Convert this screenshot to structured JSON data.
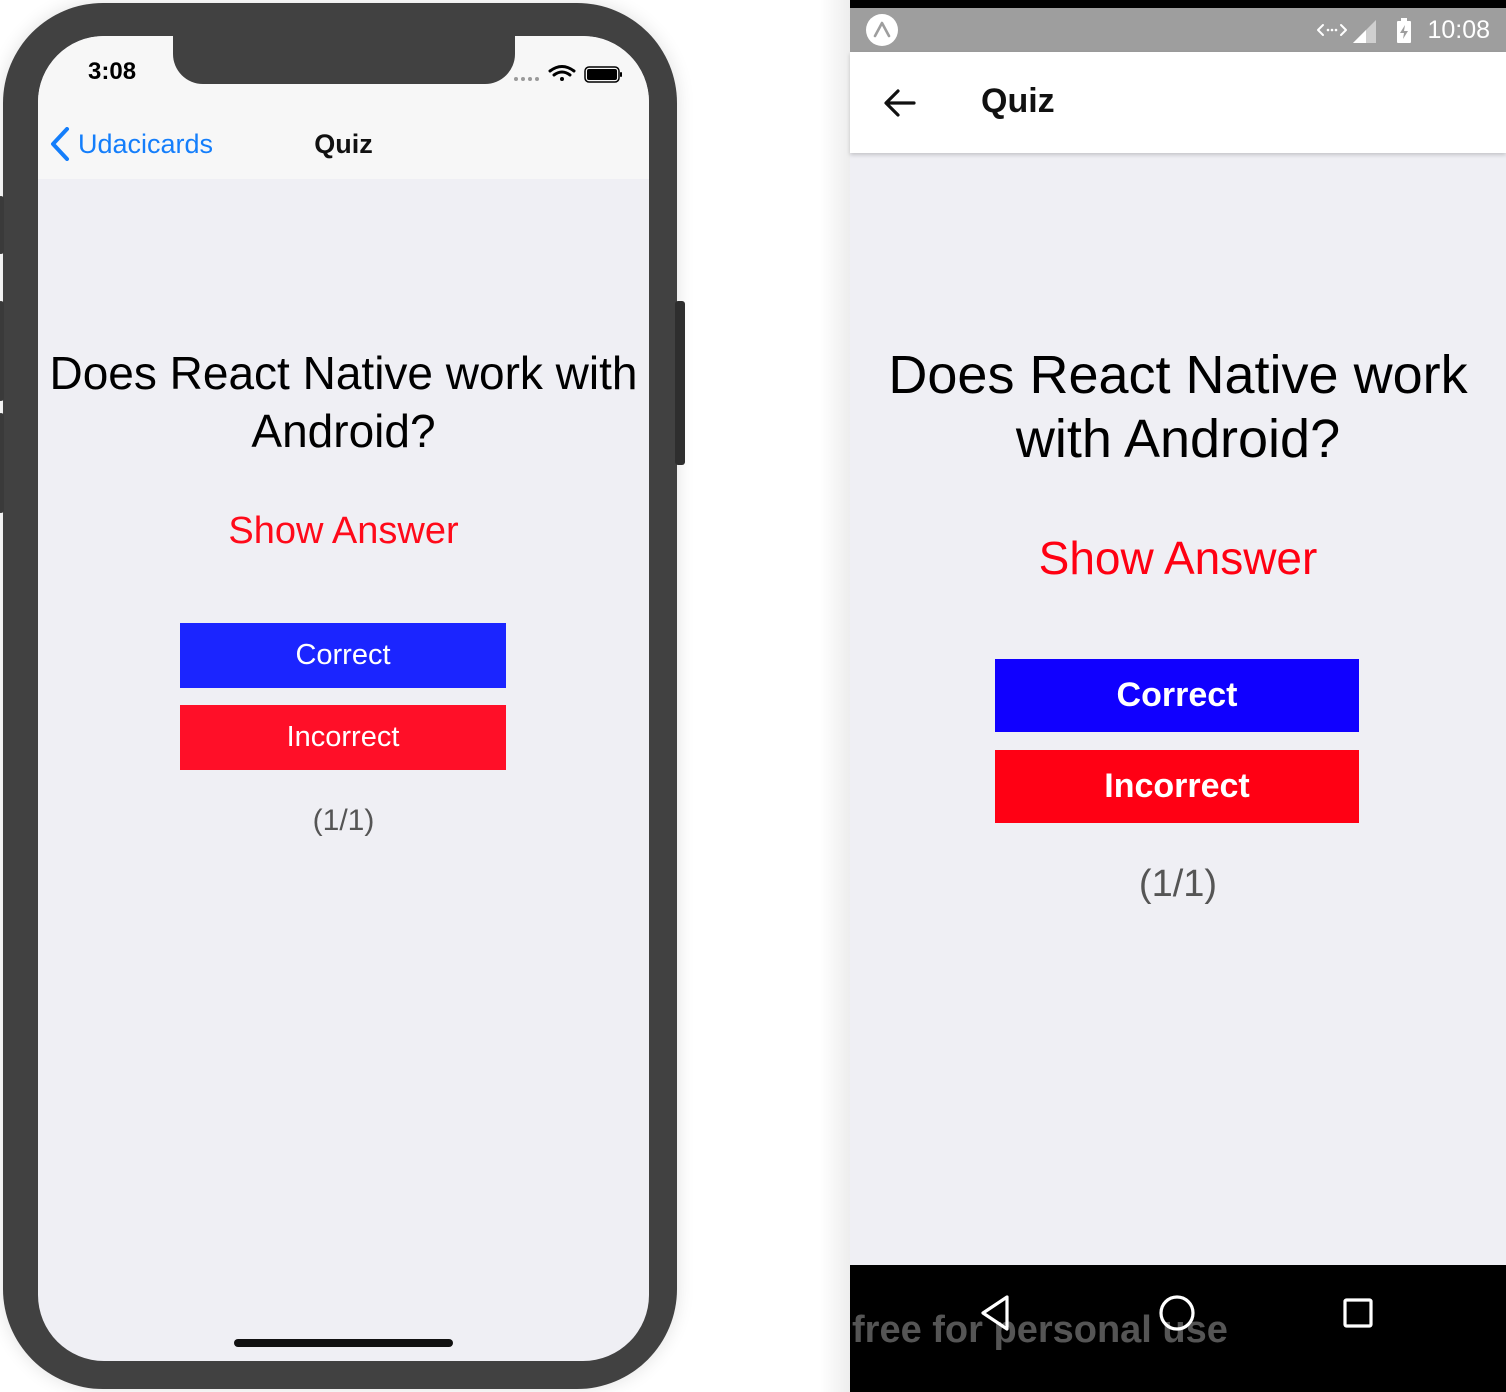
{
  "ios": {
    "status_time": "3:08",
    "nav": {
      "back_label": "Udacicards",
      "title": "Quiz"
    },
    "question": "Does React Native work with Android?",
    "show_answer": "Show Answer",
    "correct_label": "Correct",
    "incorrect_label": "Incorrect",
    "progress": "(1/1)"
  },
  "android": {
    "status_time": "10:08",
    "title": "Quiz",
    "question": "Does React Native work with Android?",
    "show_answer": "Show Answer",
    "correct_label": "Correct",
    "incorrect_label": "Incorrect",
    "progress": "(1/1)",
    "watermark": "free for personal use"
  },
  "colors": {
    "ios_correct": "#1b25ff",
    "ios_incorrect": "#ff0f28",
    "ios_link": "#147efb",
    "android_correct": "#1000ff",
    "android_incorrect": "#ff0014",
    "show_answer": "#ff0012",
    "content_bg": "#efeff4"
  },
  "icons": {
    "ios_status": [
      "signal-dots-icon",
      "wifi-icon",
      "battery-icon"
    ],
    "android_status": [
      "expo-icon",
      "data-transfer-icon",
      "cell-signal-icon",
      "battery-charging-icon"
    ],
    "android_nav": [
      "back-triangle-icon",
      "home-circle-icon",
      "recents-square-icon"
    ]
  }
}
